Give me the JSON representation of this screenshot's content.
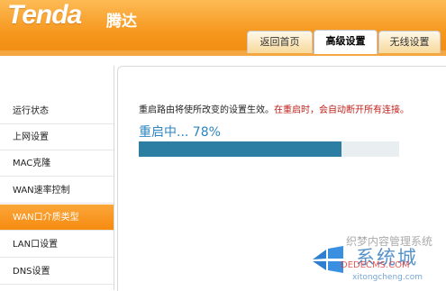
{
  "header": {
    "logo": "Tenda",
    "logo_cn": "腾达",
    "tabs": [
      {
        "label": "返回首页",
        "active": false
      },
      {
        "label": "高级设置",
        "active": true
      },
      {
        "label": "无线设置",
        "active": false
      }
    ]
  },
  "sidebar": {
    "items": [
      {
        "label": "运行状态",
        "active": false
      },
      {
        "label": "上网设置",
        "active": false
      },
      {
        "label": "MAC克隆",
        "active": false
      },
      {
        "label": "WAN速率控制",
        "active": false
      },
      {
        "label": "WAN口介质类型",
        "active": true
      },
      {
        "label": "LAN口设置",
        "active": false
      },
      {
        "label": "DNS设置",
        "active": false
      }
    ]
  },
  "main": {
    "notice": "重启路由将使所改变的设置生效。",
    "notice_warn": "在重启时，会自动断开所有连接。",
    "progress_label": "重启中...  78%",
    "progress_percent": 78
  },
  "watermark": {
    "brand": "系统城",
    "title": "织梦内容管理系统",
    "site": "DEDECMS.COM",
    "url": "xitongcheng.com"
  },
  "colors": {
    "accent_orange": "#f6961c",
    "progress_blue": "#2c7ea3",
    "warning_red": "#c0201a"
  }
}
